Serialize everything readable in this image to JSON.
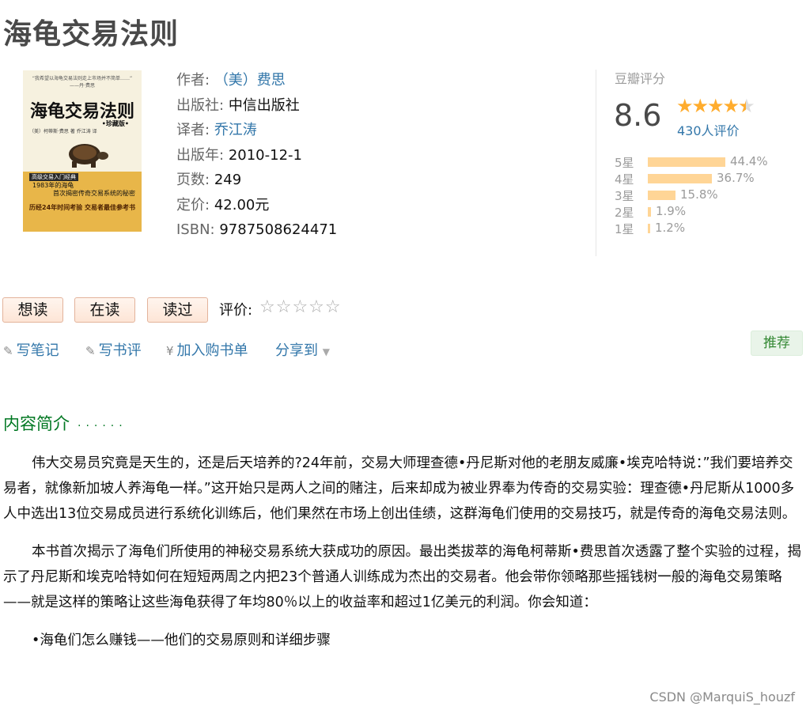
{
  "page": {
    "title": "海龟交易法则"
  },
  "cover": {
    "quote": "“我希望以海龟交易法则走上市场并不简单……”",
    "quote_author": "——丹·费思",
    "title": "海龟交易法则",
    "edition": "•珍藏版•",
    "author_line": "（美）柯蒂斯·费思 著   乔江涛 译",
    "band_tag": "高级交易入门经典",
    "band_line1": "1983年的海龟",
    "band_line2": "首次揭密传奇交易系统的秘密",
    "band_line3": "历经24年时间考验 交易者最佳参考书"
  },
  "info": {
    "author_label": "作者:",
    "author_value": "（美）费思",
    "publisher_label": "出版社:",
    "publisher_value": "中信出版社",
    "translator_label": "译者:",
    "translator_value": "乔江涛",
    "year_label": "出版年:",
    "year_value": "2010-12-1",
    "pages_label": "页数:",
    "pages_value": "249",
    "price_label": "定价:",
    "price_value": "42.00元",
    "isbn_label": "ISBN:",
    "isbn_value": "9787508624471"
  },
  "rating": {
    "title": "豆瓣评分",
    "score": "8.6",
    "stars_value": 4.5,
    "raters": "430人评价",
    "distribution": [
      {
        "label": "5星",
        "percent": 44.4,
        "text": "44.4%"
      },
      {
        "label": "4星",
        "percent": 36.7,
        "text": "36.7%"
      },
      {
        "label": "3星",
        "percent": 15.8,
        "text": "15.8%"
      },
      {
        "label": "2星",
        "percent": 1.9,
        "text": "1.9%"
      },
      {
        "label": "1星",
        "percent": 1.2,
        "text": "1.2%"
      }
    ]
  },
  "actions": {
    "want": "想读",
    "reading": "在读",
    "read": "读过",
    "rate_label": "评价:",
    "rate_stars": "☆☆☆☆☆"
  },
  "tools": {
    "note": "写笔记",
    "review": "写书评",
    "cart": "加入购书单",
    "share": "分享到",
    "recommend": "推荐"
  },
  "intro": {
    "heading": "内容简介",
    "heading_dots": "······",
    "para1": "伟大交易员究竟是天生的，还是后天培养的?24年前，交易大师理查德•丹尼斯对他的老朋友威廉•埃克哈特说：”我们要培养交易者，就像新加坡人养海龟一样。”这开始只是两人之间的赌注，后来却成为被业界奉为传奇的交易实验：理查德•丹尼斯从1000多人中选出13位交易成员进行系统化训练后，他们果然在市场上创出佳绩，这群海龟们使用的交易技巧，就是传奇的海龟交易法则。",
    "para2": "本书首次揭示了海龟们所使用的神秘交易系统大获成功的原因。最出类拔萃的海龟柯蒂斯•费思首次透露了整个实验的过程，揭示了丹尼斯和埃克哈特如何在短短两周之内把23个普通人训练成为杰出的交易者。他会带你领略那些摇钱树一般的海龟交易策略——就是这样的策略让这些海龟获得了年均80％以上的收益率和超过1亿美元的利润。你会知道：",
    "bullet1": "•海龟们怎么赚钱——他们的交易原则和详细步骤"
  },
  "watermark": "CSDN @MarquiS_houzf"
}
